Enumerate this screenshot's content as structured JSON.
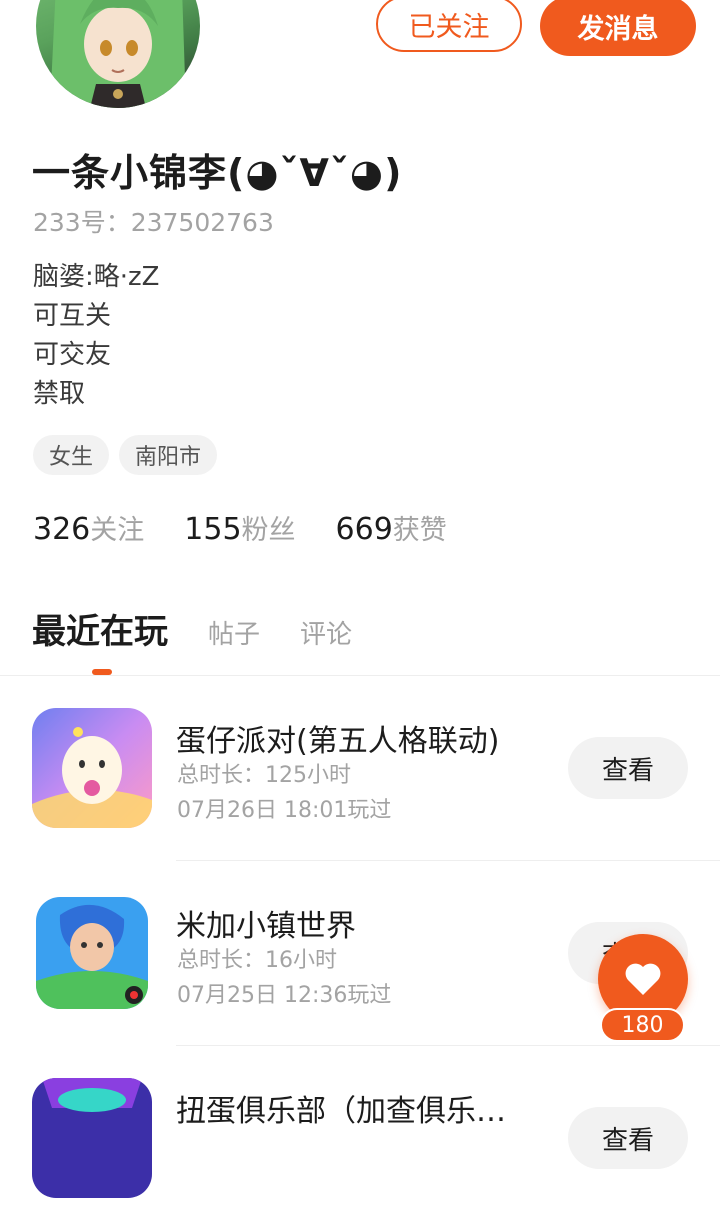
{
  "profile": {
    "name": "一条小锦李(◕ˇ∀ˇ◕)",
    "id_text": "233号：237502763",
    "bio": [
      "脑婆:略·zZ",
      "可互关",
      "可交友",
      "禁取"
    ],
    "tags": [
      "女生",
      "南阳市"
    ],
    "stats": [
      {
        "value": "326",
        "label": "关注"
      },
      {
        "value": "155",
        "label": "粉丝"
      },
      {
        "value": "669",
        "label": "获赞"
      }
    ]
  },
  "actions": {
    "followed_label": "已关注",
    "message_label": "发消息"
  },
  "tabs": [
    {
      "label": "最近在玩",
      "active": true
    },
    {
      "label": "帖子",
      "active": false
    },
    {
      "label": "评论",
      "active": false
    }
  ],
  "games": [
    {
      "title": "蛋仔派对(第五人格联动)",
      "duration": "总时长：125小时",
      "last_played": "07月26日 18:01玩过",
      "button": "查看",
      "icon": "eggy-party-icon"
    },
    {
      "title": "米加小镇世界",
      "duration": "总时长：16小时",
      "last_played": "07月25日 12:36玩过",
      "button": "查看",
      "icon": "miga-town-icon"
    },
    {
      "title": "扭蛋俱乐部（加查俱乐…",
      "duration": "",
      "last_played": "",
      "button": "查看",
      "icon": "gacha-club-icon"
    }
  ],
  "like_fab": {
    "count": "180",
    "icon": "heart-icon"
  },
  "colors": {
    "accent": "#f05a1e",
    "muted": "#a3a3a3",
    "chip_bg": "#f2f2f2"
  }
}
